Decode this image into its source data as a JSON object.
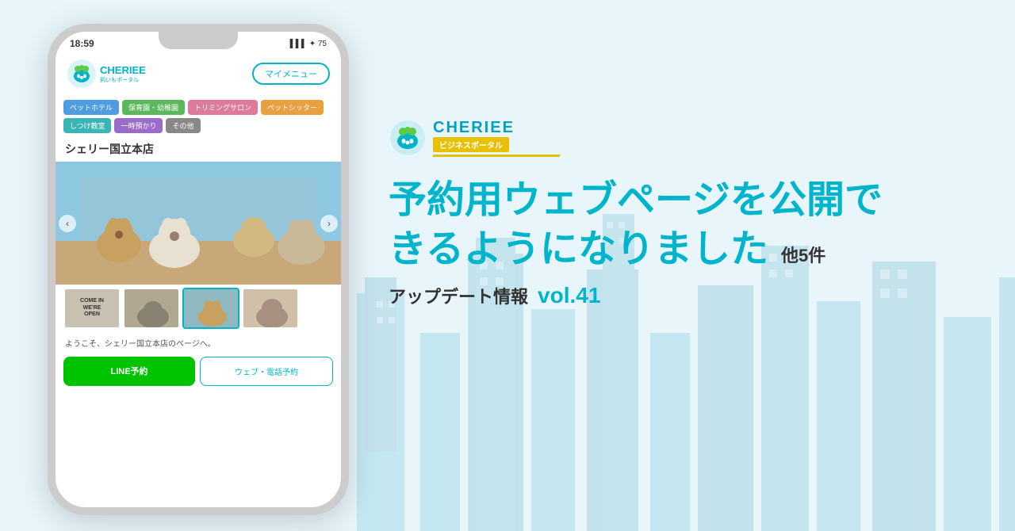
{
  "background_color": "#ddf0f7",
  "phone": {
    "time": "18:59",
    "app_name": "CHERIEE",
    "app_tagline": "飼いもポータル",
    "menu_btn": "マイメニュー",
    "tags": [
      {
        "label": "ペットホテル",
        "color": "blue"
      },
      {
        "label": "保育園・幼稚園",
        "color": "green"
      },
      {
        "label": "トリミングサロン",
        "color": "pink"
      },
      {
        "label": "ペットシッター",
        "color": "orange"
      },
      {
        "label": "しつけ教室",
        "color": "teal"
      },
      {
        "label": "一時預かり",
        "color": "purple"
      },
      {
        "label": "その他",
        "color": "gray"
      }
    ],
    "store_name": "シェリー国立本店",
    "thumb_open_sign": "COME IN\nWE'RE\nOPEN",
    "welcome_text": "ようこそ、シェリー国立本店のページへ。",
    "btn_line": "LINE予約",
    "btn_web": "ウェブ・電話予約"
  },
  "right": {
    "logo_name": "CHERIEE",
    "logo_sub": "ビジネスポータル",
    "headline_line1": "予約用ウェブページを公開で",
    "headline_line2": "きるようになりました",
    "other_label": "他5件",
    "update_label": "アップデート情報",
    "update_vol": "vol.41"
  }
}
